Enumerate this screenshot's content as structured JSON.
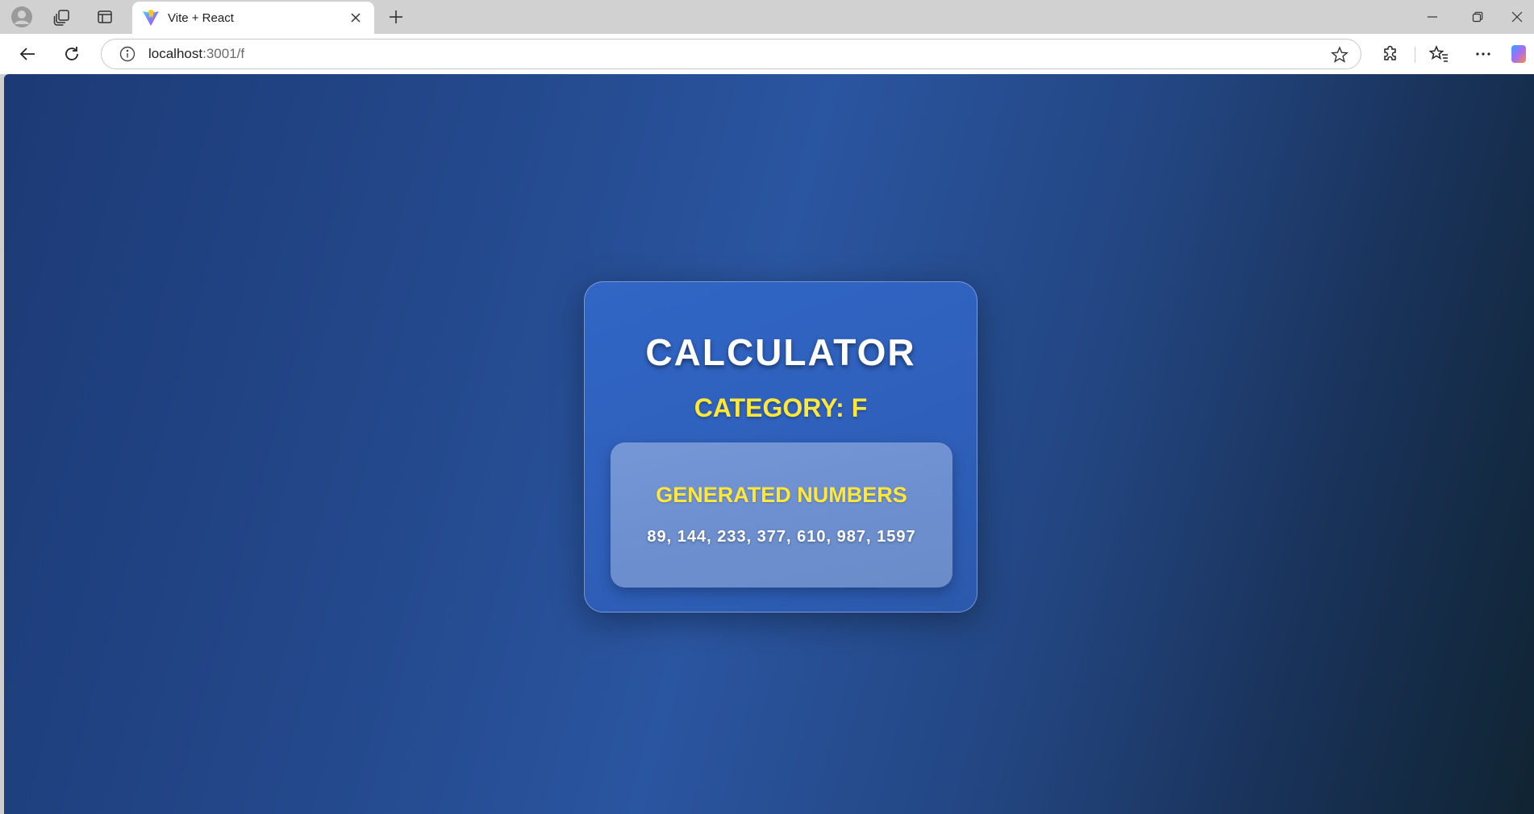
{
  "browser": {
    "tab_title": "Vite + React",
    "url_host": "localhost",
    "url_rest": ":3001/f"
  },
  "card": {
    "title": "CALCULATOR",
    "category": "CATEGORY: F",
    "panel_title": "GENERATED NUMBERS",
    "numbers": "89, 144, 233, 377, 610, 987, 1597"
  },
  "colors": {
    "accent_yellow": "#ffe83a",
    "card_blue": "#2e5fba",
    "panel_blue": "#6d8fcf"
  },
  "icons": {
    "profile": "profile-icon",
    "workspaces": "workspaces-icon",
    "vertical_tabs": "vertical-tabs-icon",
    "tab_favicon": "vite-logo-icon",
    "back": "back-arrow-icon",
    "refresh": "refresh-icon",
    "site_info": "info-icon",
    "favorite": "star-icon",
    "extensions": "extensions-icon",
    "favorites": "favorites-icon",
    "more": "more-icon",
    "copilot": "copilot-icon"
  }
}
